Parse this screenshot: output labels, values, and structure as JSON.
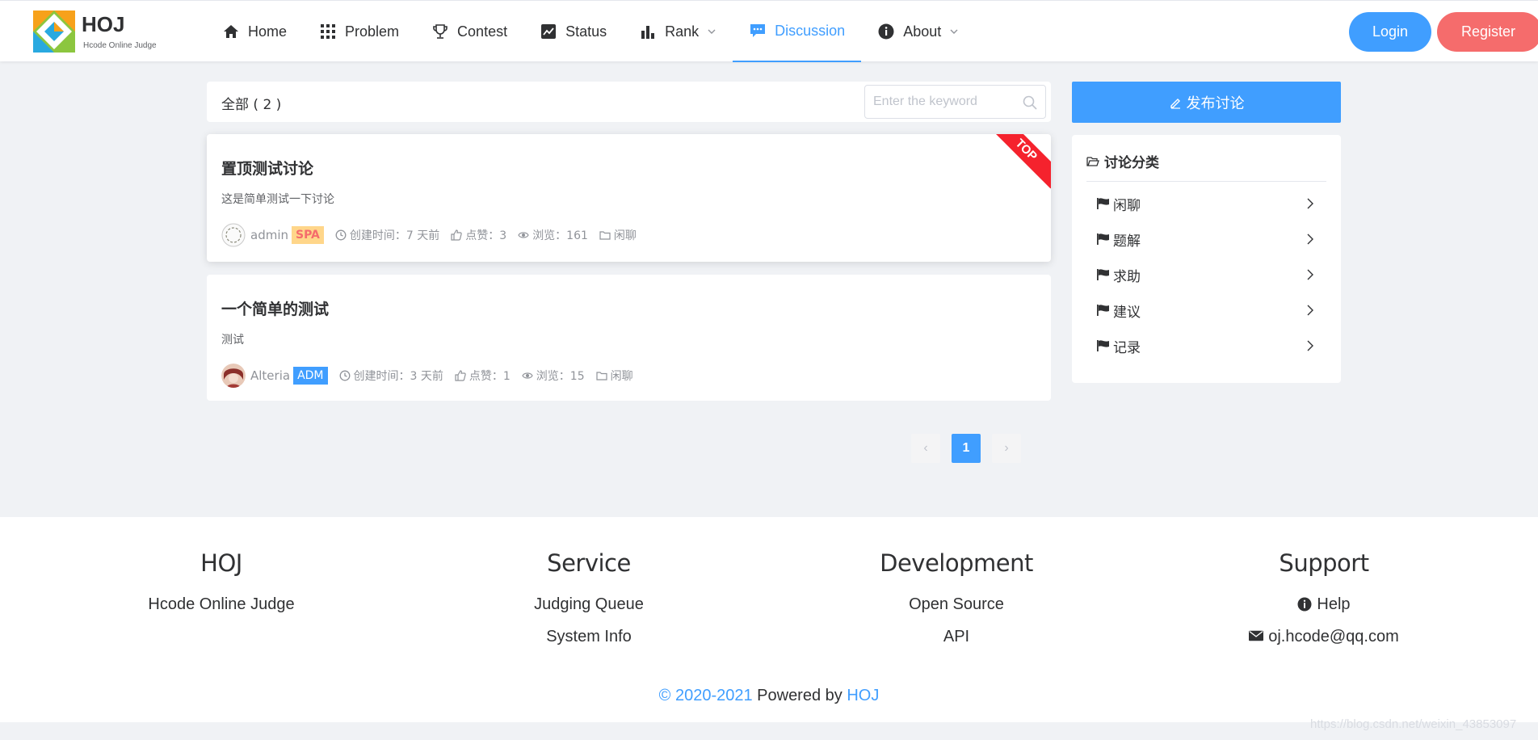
{
  "header": {
    "logo_title": "HOJ",
    "logo_subtitle": "Hcode Online Judge",
    "nav": [
      {
        "label": "Home",
        "icon": "home-icon"
      },
      {
        "label": "Problem",
        "icon": "grid-icon"
      },
      {
        "label": "Contest",
        "icon": "trophy-icon"
      },
      {
        "label": "Status",
        "icon": "trend-icon"
      },
      {
        "label": "Rank",
        "icon": "bar-chart-icon"
      },
      {
        "label": "Discussion",
        "icon": "chat-icon",
        "active": true
      },
      {
        "label": "About",
        "icon": "info-icon"
      }
    ],
    "login_label": "Login",
    "register_label": "Register"
  },
  "filter": {
    "label": "全部 ( 2 )",
    "search_placeholder": "Enter the keyword"
  },
  "discussions": [
    {
      "title": "置顶测试讨论",
      "desc": "这是简单测试一下讨论",
      "author": "admin",
      "badge": "SPA",
      "created": "创建时间：7 天前",
      "likes": "点赞：3",
      "views": "浏览：161",
      "category": "闲聊",
      "top_label": "TOP"
    },
    {
      "title": "一个简单的测试",
      "desc": "测试",
      "author": "Alteria",
      "badge": "ADM",
      "created": "创建时间：3 天前",
      "likes": "点赞：1",
      "views": "浏览：15",
      "category": "闲聊"
    }
  ],
  "pagination": {
    "prev": "‹",
    "current": "1",
    "next": "›"
  },
  "sidebar": {
    "post_button": "发布讨论",
    "category_title": "讨论分类",
    "categories": [
      "闲聊",
      "题解",
      "求助",
      "建议",
      "记录"
    ]
  },
  "footer": {
    "columns": [
      {
        "title": "HOJ",
        "links": [
          "Hcode Online Judge"
        ]
      },
      {
        "title": "Service",
        "links": [
          "Judging Queue",
          "System Info"
        ]
      },
      {
        "title": "Development",
        "links": [
          "Open Source",
          "API"
        ]
      },
      {
        "title": "Support",
        "links": [
          "Help",
          "oj.hcode@qq.com"
        ]
      }
    ],
    "copyright_year": "© 2020-2021",
    "powered_by": "Powered by",
    "powered_name": "HOJ"
  },
  "watermark": "https://blog.csdn.net/weixin_43853097",
  "colors": {
    "primary": "#409eff",
    "danger": "#f56c6c",
    "top_ribbon": "#f5222d",
    "badge_spa_bg": "#ffd68a"
  }
}
